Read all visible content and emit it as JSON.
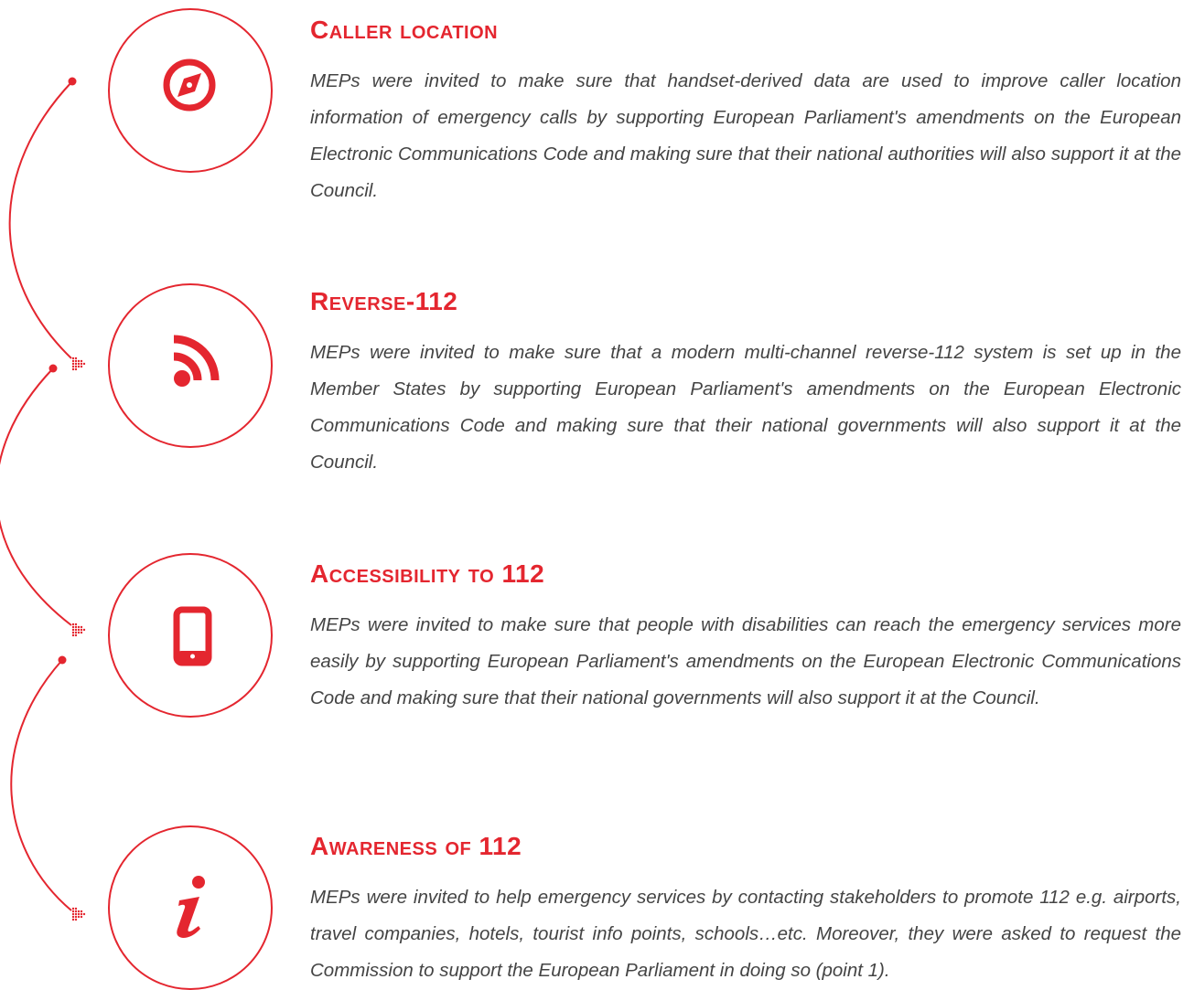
{
  "accent_color": "#e4262f",
  "text_color": "#444444",
  "sections": [
    {
      "icon": "compass-icon",
      "title": "Caller location",
      "text": "MEPs were invited to make sure that handset-derived data are used to improve caller location information of emergency calls by supporting European Parliament's amendments on the European Electronic Communications Code and making sure that their national authorities will also support it at the Council."
    },
    {
      "icon": "rss-feed-icon",
      "title": "Reverse-112",
      "text": "MEPs were invited to make sure that a modern multi-channel reverse-112 system is set up in the Member States by supporting European Parliament's amendments on the European Electronic Communications Code and making sure that their national governments will also support it at the Council."
    },
    {
      "icon": "mobile-phone-icon",
      "title": "Accessibility to 112",
      "text": "MEPs were invited to make sure that people with disabilities can reach the emergency services more easily by supporting European Parliament's amendments on the European Electronic Communications Code and making sure that their national governments will also support it at the Council."
    },
    {
      "icon": "info-icon",
      "title": "Awareness of 112",
      "text": "MEPs were invited to help emergency services by contacting stakeholders to promote 112 e.g. airports, travel companies, hotels, tourist info points, schools…etc. Moreover, they were asked to request the Commission to support the European Parliament in doing so (point 1)."
    }
  ]
}
